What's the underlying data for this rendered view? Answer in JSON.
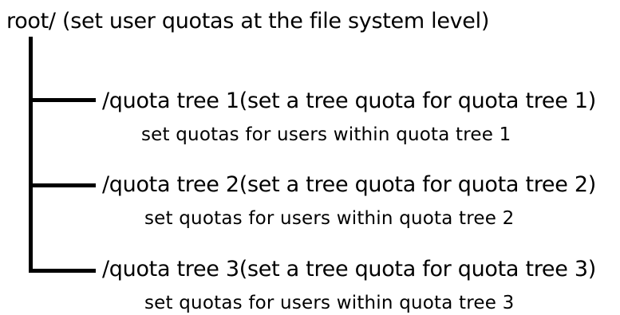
{
  "root": {
    "label": "root/ (set user quotas at the file system level)"
  },
  "branches": [
    {
      "title": "/quota tree 1(set a tree quota for quota tree 1)",
      "subtitle": "set quotas for users within quota tree 1"
    },
    {
      "title": "/quota tree 2(set a tree quota for quota tree 2)",
      "subtitle": "set quotas for users within quota tree 2"
    },
    {
      "title": "/quota tree 3(set a tree quota for quota tree 3)",
      "subtitle": "set quotas for users within quota tree 3"
    }
  ]
}
